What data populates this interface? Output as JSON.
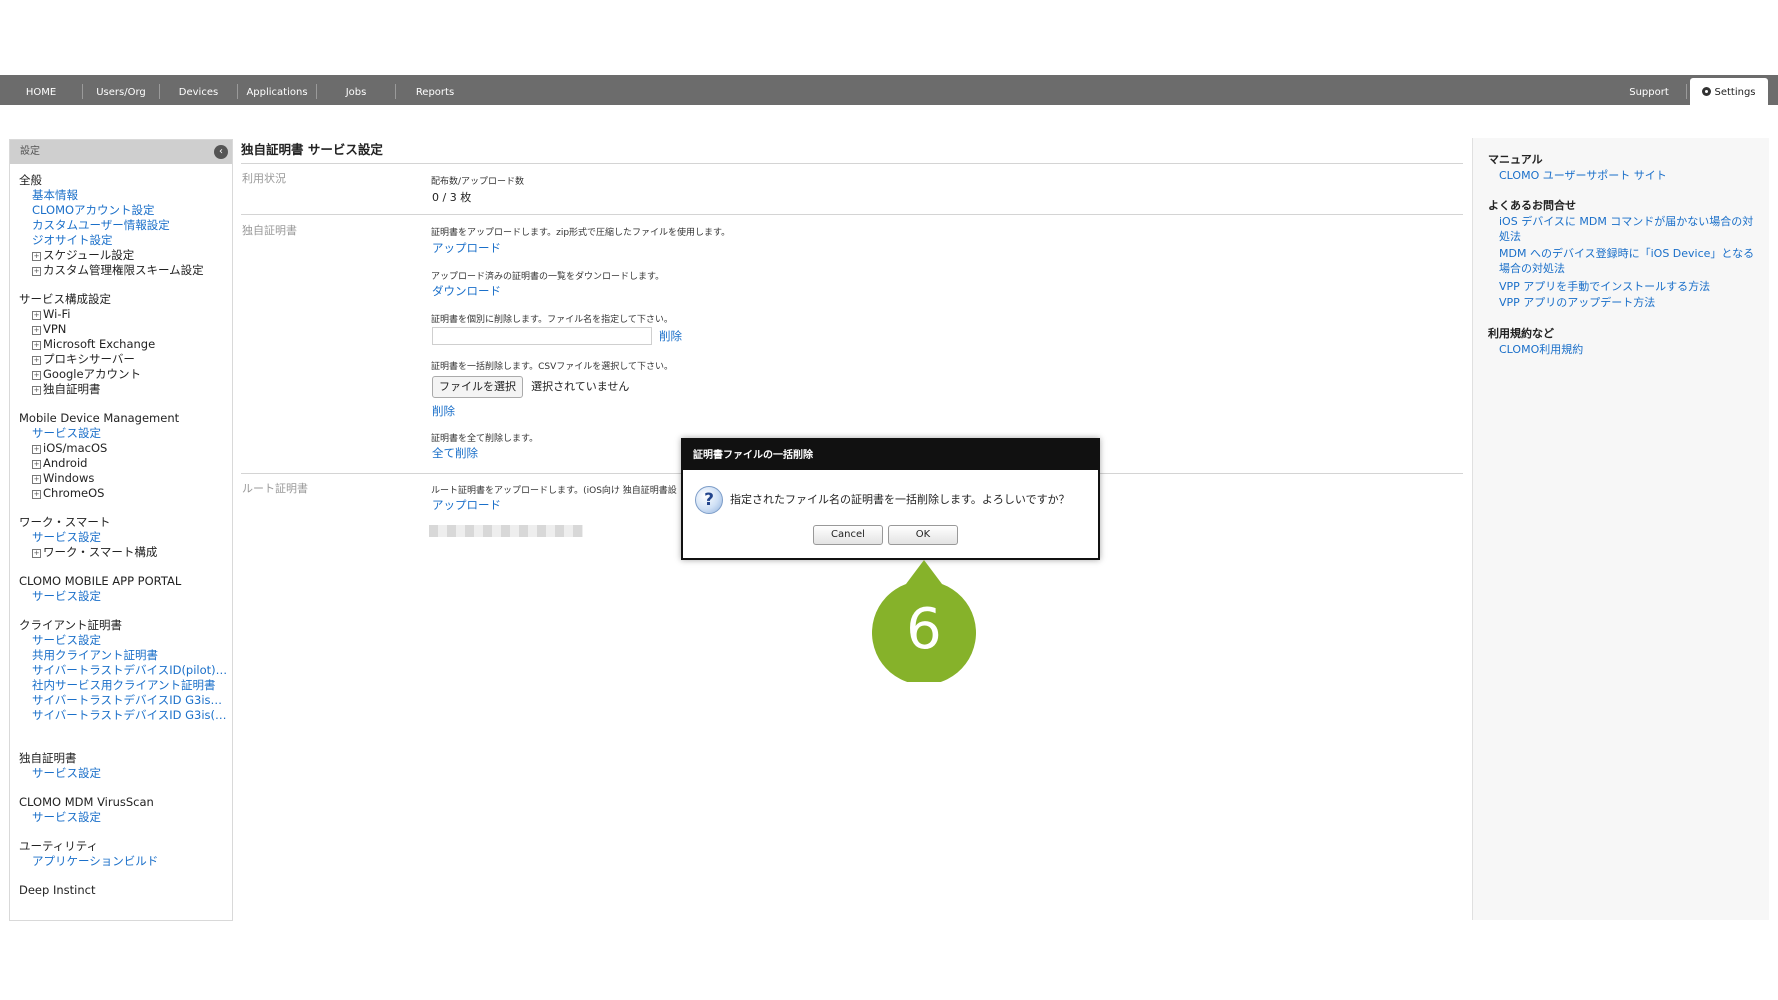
{
  "nav": {
    "items": [
      "HOME",
      "Users/Org",
      "Devices",
      "Applications",
      "Jobs",
      "Reports"
    ],
    "support": "Support",
    "settings": "Settings"
  },
  "sidebar": {
    "header": "設定",
    "sections": {
      "general": {
        "title": "全般",
        "links": [
          "基本情報",
          "CLOMOアカウント設定",
          "カスタムユーザー情報設定",
          "ジオサイト設定"
        ],
        "expandables": [
          "スケジュール設定",
          "カスタム管理権限スキーム設定"
        ]
      },
      "service_config": {
        "title": "サービス構成設定",
        "expandables": [
          "Wi-Fi",
          "VPN",
          "Microsoft Exchange",
          "プロキシサーバー",
          "Googleアカウント",
          "独自証明書"
        ]
      },
      "mdm": {
        "title": "Mobile Device Management",
        "link": "サービス設定",
        "expandables": [
          "iOS/macOS",
          "Android",
          "Windows",
          "ChromeOS"
        ]
      },
      "work_smart": {
        "title": "ワーク・スマート",
        "link": "サービス設定",
        "expandables": [
          "ワーク・スマート構成"
        ]
      },
      "app_portal": {
        "title": "CLOMO MOBILE APP PORTAL",
        "link": "サービス設定"
      },
      "client_cert": {
        "title": "クライアント証明書",
        "links": [
          "サービス設定",
          "共用クライアント証明書",
          "サイバートラストデバイスID(pilot)…",
          "社内サービス用クライアント証明書",
          "サイバートラストデバイスID G3is…",
          "サイバートラストデバイスID G3is(…"
        ]
      },
      "own_cert": {
        "title": "独自証明書",
        "link": "サービス設定"
      },
      "virusscan": {
        "title": "CLOMO MDM VirusScan",
        "link": "サービス設定"
      },
      "utility": {
        "title": "ユーティリティ",
        "link": "アプリケーションビルド"
      },
      "deep_instinct": {
        "title": "Deep Instinct"
      }
    }
  },
  "main": {
    "title": "独自証明書 サービス設定",
    "usage": {
      "label": "利用状況",
      "desc": "配布数/アップロード数",
      "value": "0 / 3 枚"
    },
    "own_cert": {
      "label": "独自証明書",
      "upload_desc": "証明書をアップロードします。zip形式で圧縮したファイルを使用します。",
      "upload_link": "アップロード",
      "download_desc": "アップロード済みの証明書の一覧をダウンロードします。",
      "download_link": "ダウンロード",
      "delete_one_desc": "証明書を個別に削除します。ファイル名を指定して下さい。",
      "delete_one_link": "削除",
      "bulk_desc": "証明書を一括削除します。CSVファイルを選択して下さい。",
      "file_button": "ファイルを選択",
      "file_status": "選択されていません",
      "bulk_delete_link": "削除",
      "delete_all_desc": "証明書を全て削除します。",
      "delete_all_link": "全て削除"
    },
    "root_cert": {
      "label": "ルート証明書",
      "desc": "ルート証明書をアップロードします。(iOS向け 独自証明書設",
      "upload_link": "アップロード"
    }
  },
  "right_panel": {
    "manual_title": "マニュアル",
    "manual_link": "CLOMO ユーザーサポート サイト",
    "faq_title": "よくあるお問合せ",
    "faq_links": [
      "iOS デバイスに MDM コマンドが届かない場合の対処法",
      "MDM へのデバイス登録時に「iOS Device」となる場合の対処法",
      "VPP アプリを手動でインストールする方法",
      "VPP アプリのアップデート方法"
    ],
    "terms_title": "利用規約など",
    "terms_link": "CLOMO利用規約"
  },
  "dialog": {
    "title": "証明書ファイルの一括削除",
    "message": "指定されたファイル名の証明書を一括削除します。よろしいですか？",
    "cancel": "Cancel",
    "ok": "OK",
    "icon": "question-icon"
  },
  "step_marker": {
    "number": "6",
    "color": "#86b22a"
  }
}
